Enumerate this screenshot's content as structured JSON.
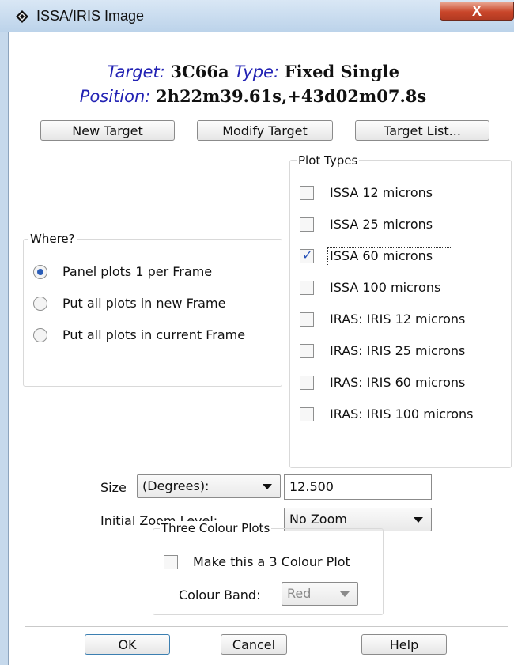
{
  "window": {
    "title": "ISSA/IRIS Image",
    "close_label": "X",
    "icon": "diamond-app-icon"
  },
  "target": {
    "target_label": "Target:",
    "target_value": "3C66a",
    "type_label": "Type:",
    "type_value": "Fixed Single",
    "position_label": "Position:",
    "position_value": "2h22m39.61s,+43d02m07.8s"
  },
  "target_buttons": {
    "new": "New Target",
    "modify": "Modify Target",
    "list": "Target List..."
  },
  "plot_types": {
    "title": "Plot Types",
    "items": [
      {
        "label": "ISSA 12 microns",
        "checked": false
      },
      {
        "label": "ISSA 25 microns",
        "checked": false
      },
      {
        "label": "ISSA 60 microns",
        "checked": true
      },
      {
        "label": "ISSA 100 microns",
        "checked": false
      },
      {
        "label": "IRAS: IRIS 12 microns",
        "checked": false
      },
      {
        "label": "IRAS: IRIS 25 microns",
        "checked": false
      },
      {
        "label": "IRAS: IRIS 60 microns",
        "checked": false
      },
      {
        "label": "IRAS: IRIS 100 microns",
        "checked": false
      }
    ]
  },
  "where": {
    "title": "Where?",
    "options": [
      {
        "label": "Panel plots 1 per Frame",
        "selected": true
      },
      {
        "label": "Put all plots in new Frame",
        "selected": false
      },
      {
        "label": "Put all plots in current Frame",
        "selected": false
      }
    ]
  },
  "size": {
    "label": "Size",
    "unit_selected": "(Degrees):",
    "value": "12.500"
  },
  "zoom": {
    "label": "Initial Zoom Level:",
    "selected": "No Zoom"
  },
  "three_colour": {
    "title": "Three Colour Plots",
    "checkbox_label": "Make this a 3 Colour Plot",
    "checked": false,
    "band_label": "Colour Band:",
    "band_selected": "Red"
  },
  "footer": {
    "ok": "OK",
    "cancel": "Cancel",
    "help": "Help"
  },
  "colors": {
    "accent": "#2323b4",
    "selected_radio": "#2a5db8",
    "check": "#2a54b8"
  }
}
